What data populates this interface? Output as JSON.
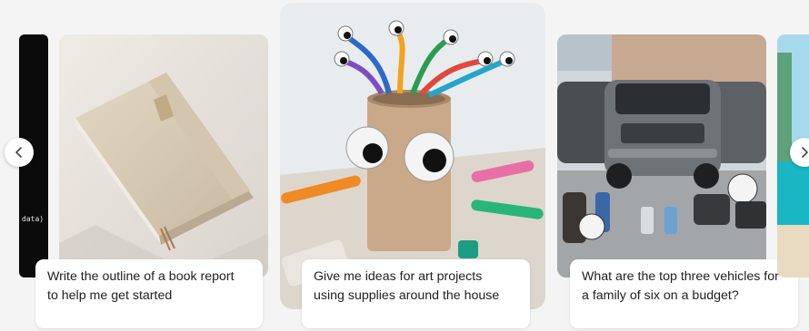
{
  "cards": [
    {
      "caption_line1": "Write the outline of a book report",
      "caption_line2": "to help me get started",
      "image": "notebook-image"
    },
    {
      "caption_line1": "Give me ideas for art projects",
      "caption_line2": "using supplies around the house",
      "image": "toilet-roll-craft-image"
    },
    {
      "caption_line1": "What are the top three vehicles for",
      "caption_line2": "a family of six on a budget?",
      "image": "suv-vehicles-image"
    }
  ],
  "left_partial_card": {
    "code_text": "data)"
  },
  "nav": {
    "prev_icon": "chevron-left-icon",
    "next_icon": "chevron-right-icon"
  }
}
